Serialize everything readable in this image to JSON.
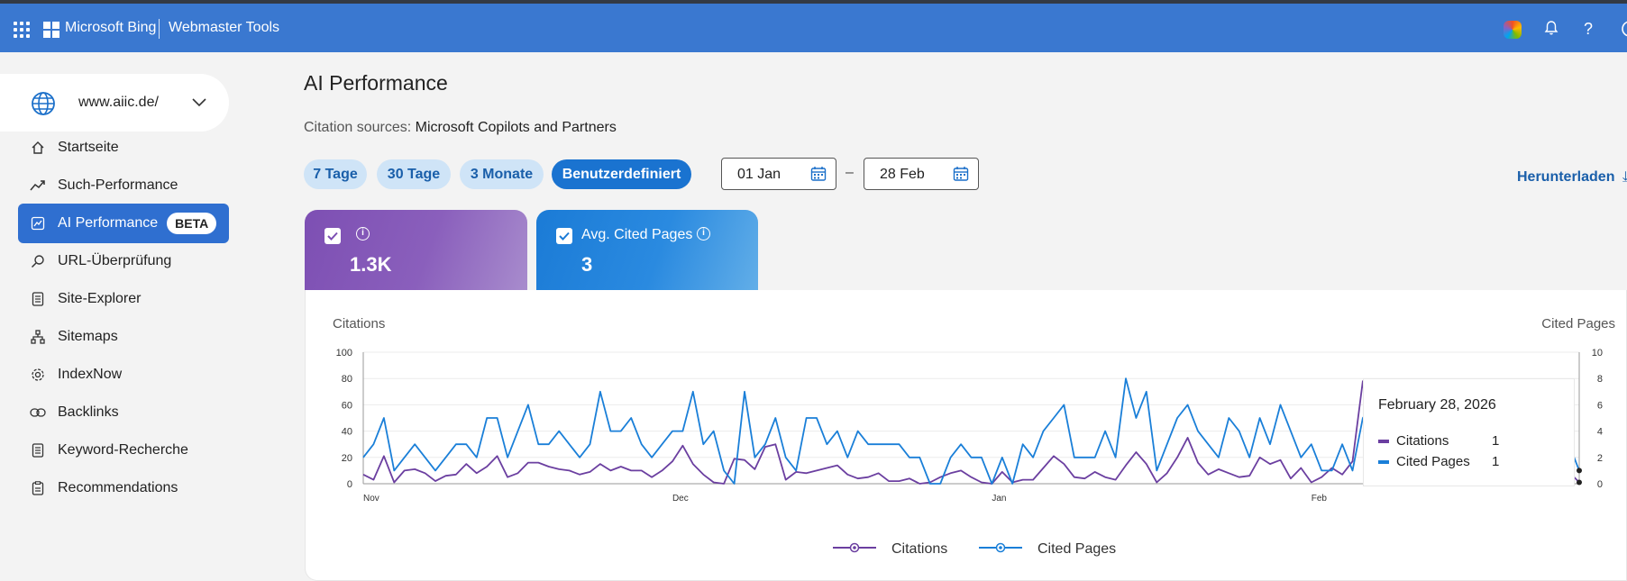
{
  "header": {
    "brand": "Microsoft Bing",
    "product": "Webmaster Tools",
    "icons": [
      "app-launcher-icon",
      "copilot-icon",
      "bell-icon",
      "help-icon"
    ]
  },
  "sidebar": {
    "site": "www.aiic.de/",
    "items": [
      {
        "label": "Startseite",
        "icon": "home-icon"
      },
      {
        "label": "Such-Performance",
        "icon": "trend-icon"
      },
      {
        "label": "AI Performance",
        "icon": "ai-chart-icon",
        "badge": "BETA",
        "active": true
      },
      {
        "label": "URL-Überprüfung",
        "icon": "search-icon"
      },
      {
        "label": "Site-Explorer",
        "icon": "document-icon"
      },
      {
        "label": "Sitemaps",
        "icon": "sitemap-icon"
      },
      {
        "label": "IndexNow",
        "icon": "gear-icon"
      },
      {
        "label": "Backlinks",
        "icon": "link-icon"
      },
      {
        "label": "Keyword-Recherche",
        "icon": "document-icon"
      },
      {
        "label": "Recommendations",
        "icon": "clipboard-icon"
      }
    ]
  },
  "main": {
    "title": "AI Performance",
    "citation_label": "Citation sources:",
    "citation_value": "Microsoft Copilots and Partners",
    "ranges": [
      "7 Tage",
      "30 Tage",
      "3 Monate",
      "Benutzerdefiniert"
    ],
    "active_range": "Benutzerdefiniert",
    "date_from": "01 Jan",
    "date_sep": "–",
    "date_to": "28 Feb",
    "download": "Herunterladen"
  },
  "metrics": [
    {
      "label": "",
      "value": "1.3K",
      "checked": true,
      "color": "#7d4fb3"
    },
    {
      "label": "Avg. Cited Pages",
      "value": "3",
      "checked": true,
      "color": "#1b7bd6"
    }
  ],
  "tooltip": {
    "date": "February 28, 2026",
    "rows": [
      {
        "name": "Citations",
        "value": "1",
        "color": "#6b3fa0"
      },
      {
        "name": "Cited Pages",
        "value": "1",
        "color": "#1a7fd8"
      }
    ]
  },
  "chart_data": {
    "type": "line",
    "ylabel_left": "Citations",
    "ylabel_right": "Cited Pages",
    "ylim_left": [
      0,
      100
    ],
    "ylim_right": [
      0,
      10
    ],
    "yticks_left": [
      0,
      20,
      40,
      60,
      80,
      100
    ],
    "yticks_right": [
      0,
      2,
      4,
      6,
      8,
      10
    ],
    "xtick_labels": [
      "Nov",
      "Dec",
      "Jan",
      "Feb"
    ],
    "xtick_index": [
      0,
      30,
      61,
      92
    ],
    "grid": true,
    "legend_position": "bottom",
    "series": [
      {
        "name": "Citations",
        "axis": "left",
        "color": "#6b3fa0",
        "values": [
          7,
          3,
          21,
          1,
          10,
          11,
          8,
          2,
          6,
          7,
          15,
          8,
          13,
          21,
          5,
          8,
          16,
          16,
          13,
          11,
          10,
          7,
          9,
          15,
          10,
          13,
          10,
          10,
          5,
          10,
          17,
          29,
          15,
          7,
          1,
          0,
          19,
          18,
          11,
          28,
          30,
          3,
          9,
          8,
          10,
          12,
          14,
          7,
          4,
          5,
          8,
          2,
          2,
          4,
          0,
          1,
          5,
          8,
          10,
          5,
          1,
          0,
          9,
          1,
          3,
          3,
          12,
          21,
          15,
          5,
          4,
          9,
          5,
          3,
          14,
          24,
          15,
          1,
          8,
          20,
          35,
          16,
          7,
          11,
          8,
          5,
          6,
          20,
          15,
          18,
          4,
          12,
          1,
          5,
          12,
          7,
          17,
          78,
          15,
          0,
          0,
          0,
          0,
          0,
          0,
          0,
          0,
          0,
          0,
          0,
          0,
          0,
          0,
          0,
          0,
          0,
          0,
          9,
          1
        ]
      },
      {
        "name": "Cited Pages",
        "axis": "right",
        "color": "#1a7fd8",
        "values": [
          2,
          3,
          5,
          1,
          2,
          3,
          2,
          1,
          2,
          3,
          3,
          2,
          5,
          5,
          2,
          4,
          6,
          3,
          3,
          4,
          3,
          2,
          3,
          7,
          4,
          4,
          5,
          3,
          2,
          3,
          4,
          4,
          7,
          3,
          4,
          1,
          0,
          7,
          2,
          3,
          5,
          2,
          1,
          5,
          5,
          3,
          4,
          2,
          4,
          3,
          3,
          3,
          3,
          2,
          2,
          0,
          0,
          2,
          3,
          2,
          2,
          0,
          2,
          0,
          3,
          2,
          4,
          5,
          6,
          2,
          2,
          2,
          4,
          2,
          8,
          5,
          7,
          1,
          3,
          5,
          6,
          4,
          3,
          2,
          5,
          4,
          2,
          5,
          3,
          6,
          4,
          2,
          3,
          1,
          1,
          3,
          1,
          5,
          6,
          1,
          0,
          0,
          0,
          0,
          0,
          0,
          0,
          0,
          0,
          0,
          0,
          0,
          0,
          0,
          0,
          0,
          0,
          3,
          1
        ]
      }
    ]
  }
}
